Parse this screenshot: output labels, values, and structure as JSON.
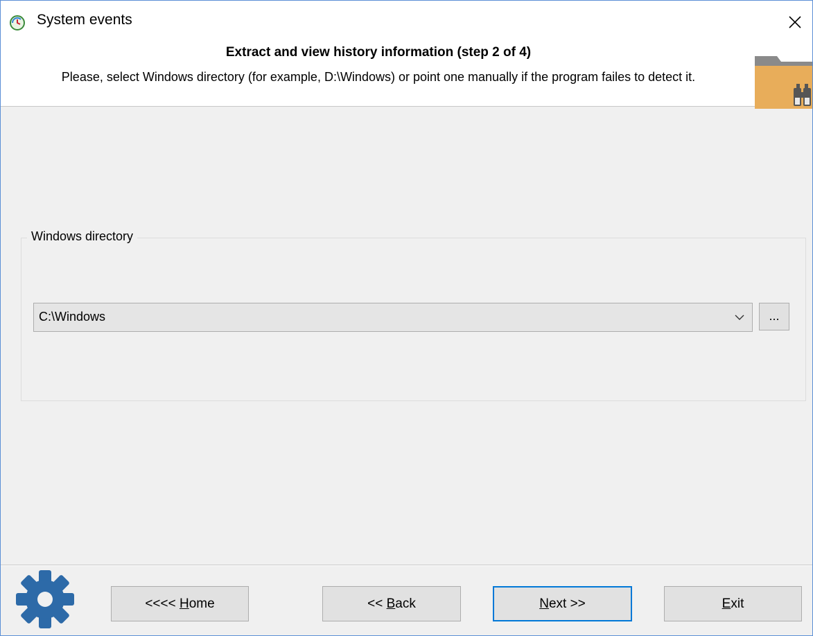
{
  "window": {
    "title": "System events",
    "close_label": "×"
  },
  "header": {
    "title": "Extract and view history information (step 2 of 4)",
    "description": "Please, select Windows directory (for example, D:\\Windows) or point one manually if the program failes to detect it."
  },
  "group": {
    "legend": "Windows directory",
    "combo_value": "C:\\Windows",
    "browse_label": "..."
  },
  "buttons": {
    "home_prefix": "<<<< ",
    "home_access": "H",
    "home_rest": "ome",
    "back_prefix": "<< ",
    "back_access": "B",
    "back_rest": "ack",
    "next_access": "N",
    "next_rest": "ext >>",
    "exit_access": "E",
    "exit_rest": "xit"
  },
  "colors": {
    "accent": "#0078d7",
    "folder": "#e8ad5a",
    "gear": "#2d6aa8"
  },
  "icons": [
    "app-icon",
    "close-icon",
    "folder-binoculars-icon",
    "chevron-down-icon",
    "gear-icon"
  ]
}
